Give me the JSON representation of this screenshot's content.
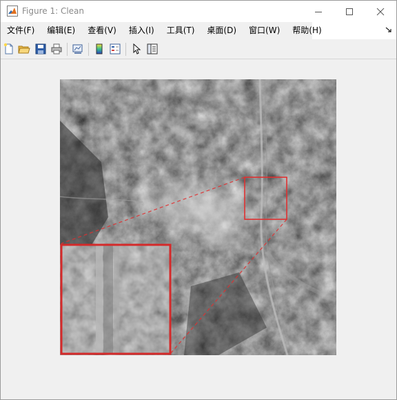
{
  "window": {
    "title": "Figure 1: Clean"
  },
  "menu": {
    "items": [
      {
        "id": "file",
        "label": "文件(F)"
      },
      {
        "id": "edit",
        "label": "编辑(E)"
      },
      {
        "id": "view",
        "label": "查看(V)"
      },
      {
        "id": "insert",
        "label": "插入(I)"
      },
      {
        "id": "tools",
        "label": "工具(T)"
      },
      {
        "id": "desktop",
        "label": "桌面(D)"
      },
      {
        "id": "window",
        "label": "窗口(W)"
      },
      {
        "id": "help",
        "label": "帮助(H)"
      }
    ]
  },
  "toolbar": {
    "buttons": [
      "new-figure-icon",
      "open-file-icon",
      "save-icon",
      "print-icon",
      "link-plot-icon",
      "insert-colorbar-icon",
      "insert-legend-icon",
      "edit-plot-icon",
      "property-inspector-icon"
    ]
  },
  "figure": {
    "image_description_icon": "grayscale-satellite-image",
    "zoom_box_color": "#e03030",
    "inset_border_color": "#d42a2a"
  }
}
